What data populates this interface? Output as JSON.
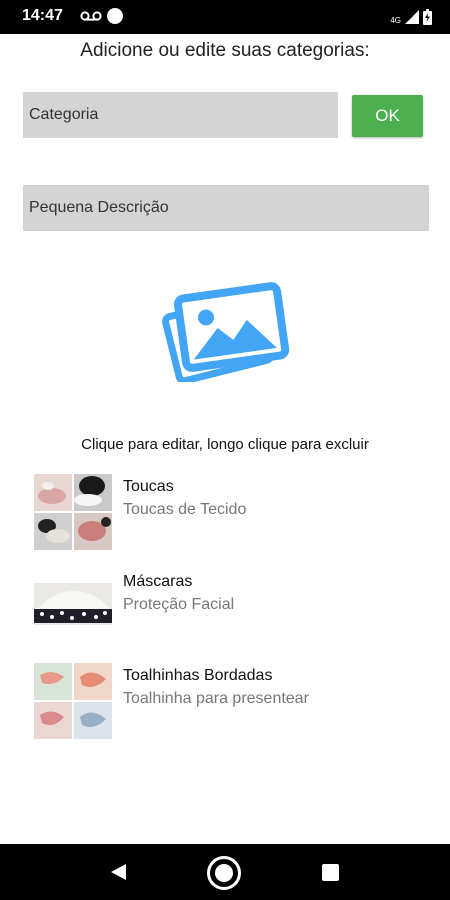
{
  "status_bar": {
    "time": "14:47",
    "network": "4G",
    "icons": [
      "voicemail-icon",
      "notification-dot-icon",
      "signal-icon",
      "battery-icon"
    ]
  },
  "form": {
    "heading": "Adicione ou edite suas categorias:",
    "category_placeholder": "Categoria",
    "description_placeholder": "Pequena Descrição",
    "ok_label": "OK",
    "image_icon": "image-gallery-icon"
  },
  "hint": "Clique para editar, longo clique para excluir",
  "categories": [
    {
      "title": "Toucas",
      "subtitle": "Toucas de Tecido"
    },
    {
      "title": "Máscaras",
      "subtitle": "Proteção Facial"
    },
    {
      "title": "Toalhinhas Bordadas",
      "subtitle": "Toalhinha para presentear"
    }
  ],
  "colors": {
    "accent": "#4caf50",
    "icon_blue": "#42a5f5",
    "field_bg": "#d4d4d4"
  },
  "nav_bar": {
    "icons": [
      "back-icon",
      "home-icon",
      "recents-icon"
    ]
  }
}
